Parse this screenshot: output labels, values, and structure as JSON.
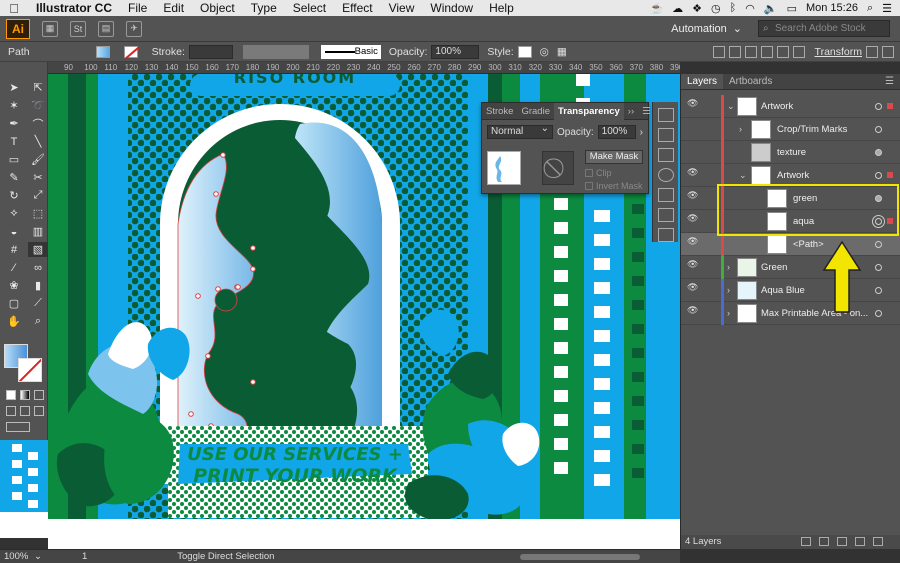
{
  "menubar": {
    "app_name": "Illustrator CC",
    "items": [
      "File",
      "Edit",
      "Object",
      "Type",
      "Select",
      "Effect",
      "View",
      "Window",
      "Help"
    ],
    "clock": "Mon 15:26"
  },
  "appbar": {
    "logo": "Ai",
    "icon_st": "St",
    "workspace": "Automation",
    "stock_search_placeholder": "Search Adobe Stock"
  },
  "control": {
    "object_type": "Path",
    "stroke_label": "Stroke:",
    "stroke_profile": "Basic",
    "opacity_label": "Opacity:",
    "opacity_value": "100%",
    "style_label": "Style:",
    "transform_label": "Transform"
  },
  "ruler": [
    "90",
    "100",
    "110",
    "120",
    "130",
    "140",
    "150",
    "160",
    "170",
    "180",
    "190",
    "200",
    "210",
    "220",
    "230",
    "240",
    "250",
    "260",
    "270",
    "280",
    "290",
    "300",
    "310",
    "320",
    "330",
    "340",
    "350",
    "360",
    "370",
    "380",
    "390"
  ],
  "artwork": {
    "header_text": "RISO ROOM",
    "line1": "USE OUR SERVICES +",
    "line2": "PRINT YOUR WORK",
    "colors": {
      "aqua": "#11a6e8",
      "green": "#0b8a40",
      "dark_green": "#0a5c35",
      "light_blue": "#7cc4ee"
    }
  },
  "transparency": {
    "tabs": [
      "Stroke",
      "Gradie",
      "Transparency"
    ],
    "blend_mode": "Normal",
    "opacity_label": "Opacity:",
    "opacity_value": "100%",
    "make_mask": "Make Mask",
    "clip": "Clip",
    "invert_mask": "Invert Mask"
  },
  "layers": {
    "tabs": [
      "Layers",
      "Artboards"
    ],
    "rows": [
      {
        "name": "Artwork",
        "color": "#d94a4a"
      },
      {
        "name": "Crop/Trim Marks",
        "color": "#d94a4a"
      },
      {
        "name": "texture",
        "color": "#d94a4a"
      },
      {
        "name": "Artwork",
        "color": "#d94a4a"
      },
      {
        "name": "green",
        "color": "#d94a4a"
      },
      {
        "name": "aqua",
        "color": "#d94a4a"
      },
      {
        "name": "<Path>",
        "color": "#d94a4a"
      },
      {
        "name": "Green",
        "color": "#3fae3f"
      },
      {
        "name": "Aqua Blue",
        "color": "#4a6ad9"
      },
      {
        "name": "Max Printable Area - on...",
        "color": "#4a6ad9"
      }
    ],
    "footer": "4 Layers"
  },
  "statusbar": {
    "zoom": "100%",
    "page": "1",
    "message": "Toggle Direct Selection"
  }
}
